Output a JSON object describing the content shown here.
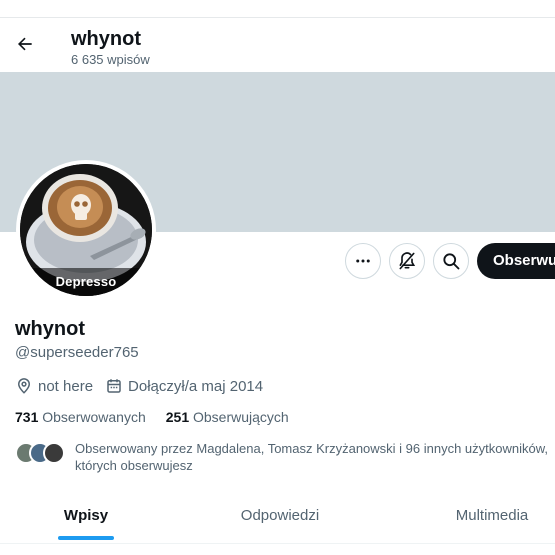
{
  "header": {
    "name": "whynot",
    "post_count": "6 635 wpisów"
  },
  "profile": {
    "avatar_caption": "Depresso",
    "name": "whynot",
    "handle": "@superseeder765",
    "location": "not here",
    "joined": "Dołączył/a maj 2014",
    "following_count": "731",
    "following_label": "Obserwowanych",
    "followers_count": "251",
    "followers_label": "Obserwujących",
    "followed_by_line1": "Obserwowany przez Magdalena, Tomasz Krzyżanowski i 96 innych użytkowników,",
    "followed_by_line2": "których obserwujesz"
  },
  "actions": {
    "follow_label": "Obserwuj"
  },
  "tabs": [
    {
      "label": "Wpisy",
      "active": true
    },
    {
      "label": "Odpowiedzi",
      "active": false
    },
    {
      "label": "Multimedia",
      "active": false
    }
  ],
  "colors": {
    "accent": "#1d9bf0",
    "text_primary": "#0f1419",
    "text_secondary": "#536471",
    "banner": "#cfd9de",
    "follow_button": "#0f1419"
  },
  "icons": {
    "back": "arrow-left-icon",
    "more": "more-icon",
    "notifications_off": "notification-off-icon",
    "search": "search-icon",
    "location": "location-icon",
    "calendar": "calendar-icon"
  }
}
